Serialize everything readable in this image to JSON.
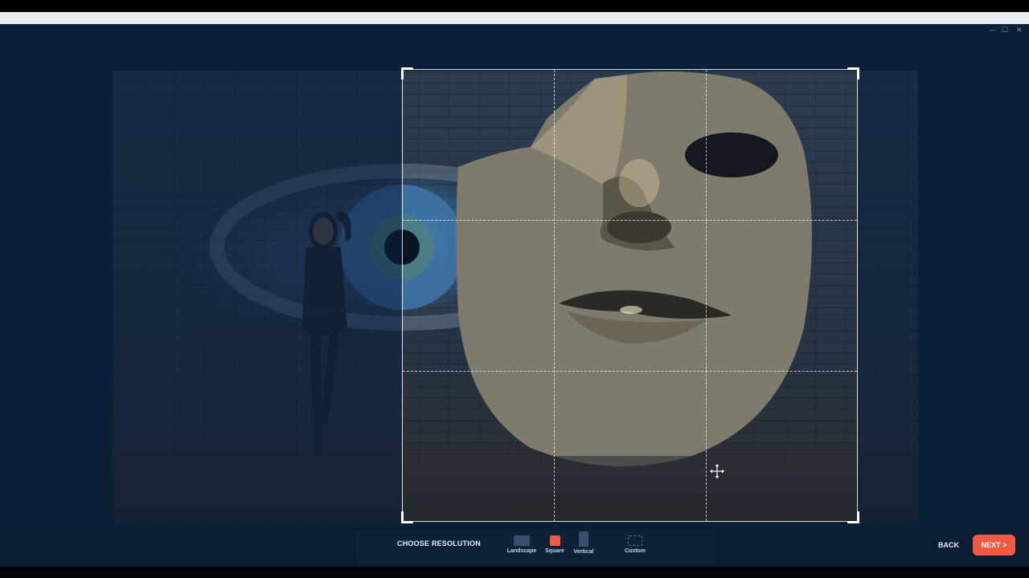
{
  "window": {
    "minimize_glyph": "—",
    "maximize_glyph": "☐",
    "close_glyph": "✕"
  },
  "editor": {
    "image_alt": "Surreal photo of a woman leaning on a brick wall beside a giant eye and a broken stone mask",
    "crop_grid": "rule-of-thirds",
    "cursor_icon": "move-cursor-icon"
  },
  "resolution_bar": {
    "label": "CHOOSE RESOLUTION",
    "options": [
      {
        "label": "Landscape",
        "icon": "landscape-icon",
        "selected": false
      },
      {
        "label": "Square",
        "icon": "square-icon",
        "selected": true
      },
      {
        "label": "Vertical",
        "icon": "vertical-icon",
        "selected": false
      },
      {
        "label": "Custom",
        "icon": "custom-icon",
        "selected": false
      }
    ]
  },
  "nav": {
    "back_label": "BACK",
    "next_label": "NEXT >"
  },
  "colors": {
    "accent": "#ef5a43",
    "background": "#0b1f38"
  }
}
